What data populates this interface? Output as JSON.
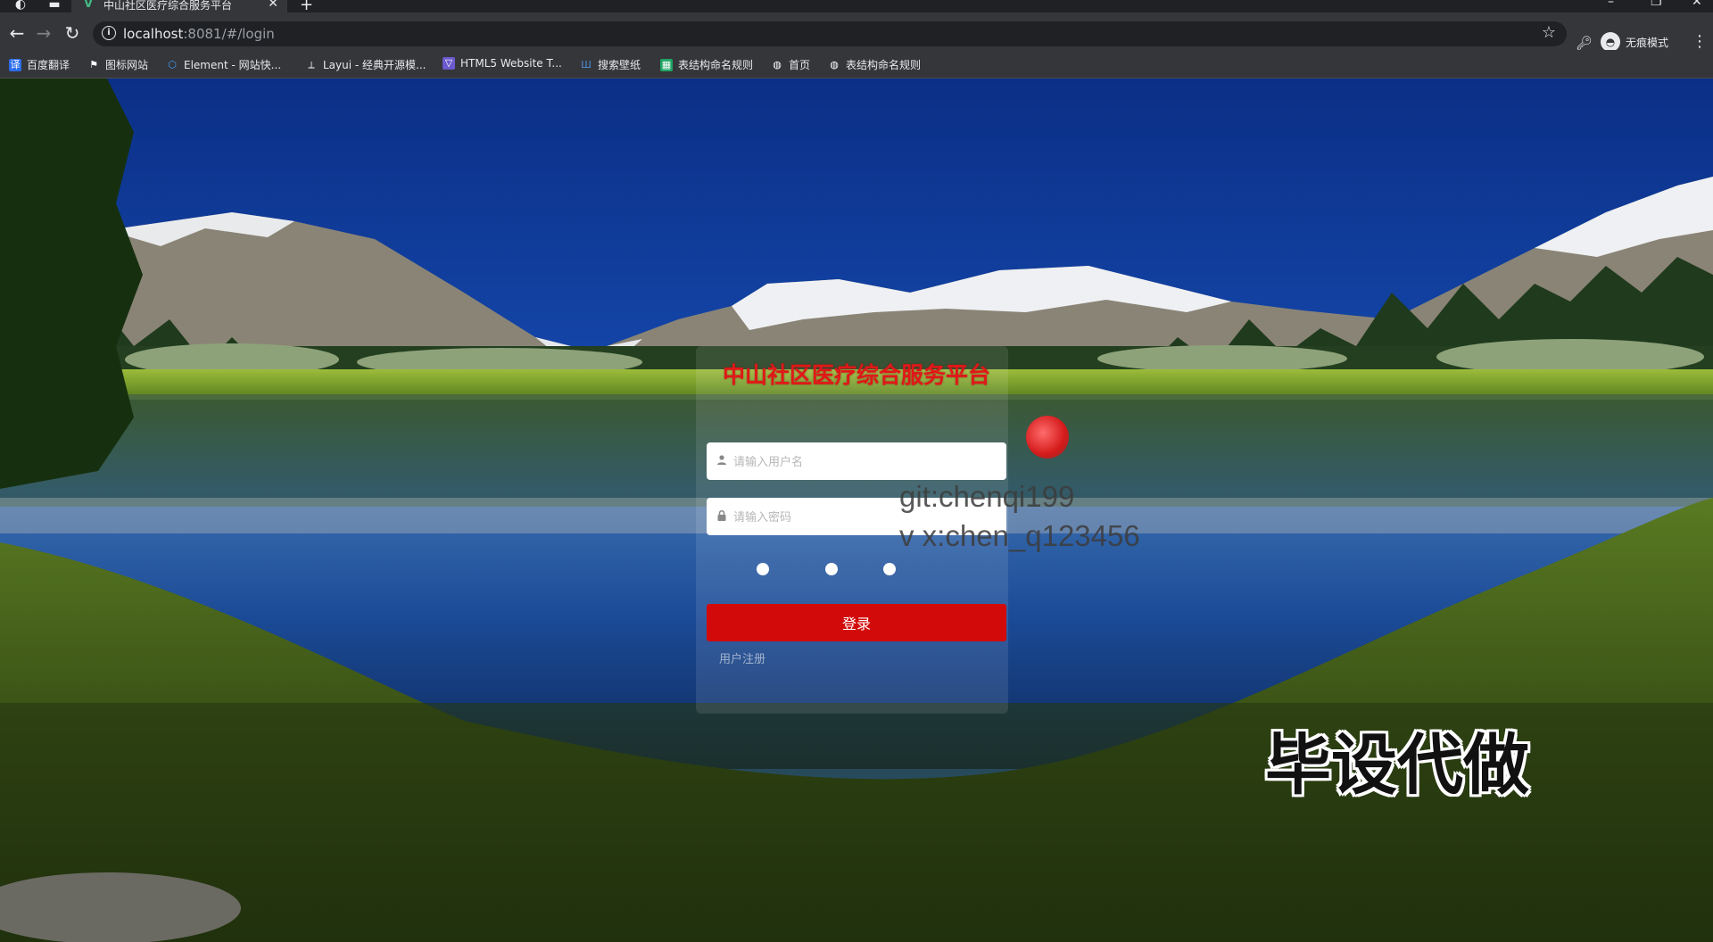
{
  "browser": {
    "tab": {
      "title": "中山社区医疗综合服务平台"
    },
    "address": {
      "host": "localhost",
      "rest": ":8081/#/login"
    },
    "profile_label": "无痕模式",
    "bookmarks": [
      {
        "label": "百度翻译",
        "icon": "translate-icon",
        "color": "#2b6dea"
      },
      {
        "label": "图标网站",
        "icon": "flag-icon",
        "color": "#ffffff"
      },
      {
        "label": "Element - 网站快...",
        "icon": "element-icon",
        "color": "#409eff"
      },
      {
        "label": "Layui - 经典开源模...",
        "icon": "layui-icon",
        "color": "#ffffff"
      },
      {
        "label": "HTML5 Website T...",
        "icon": "html5-icon",
        "color": "#6a5acd"
      },
      {
        "label": "搜索壁纸",
        "icon": "wallpaper-icon",
        "color": "#4a90d9"
      },
      {
        "label": "表结构命名规则",
        "icon": "sheet-icon",
        "color": "#1fa463"
      },
      {
        "label": "首页",
        "icon": "globe-icon",
        "color": "#ffffff"
      },
      {
        "label": "表结构命名规则",
        "icon": "globe-icon",
        "color": "#ffffff"
      }
    ]
  },
  "login": {
    "title": "中山社区医疗综合服务平台",
    "username_placeholder": "请输入用户名",
    "password_placeholder": "请输入密码",
    "submit_label": "登录",
    "register_label": "用户注册"
  },
  "overlay": {
    "watermark_line1": "git:chenqi199",
    "watermark_line2": "v x:chen_q123456",
    "caption": "毕设代做"
  },
  "colors": {
    "accent_red": "#d20a0a",
    "title_red": "#e01818"
  }
}
